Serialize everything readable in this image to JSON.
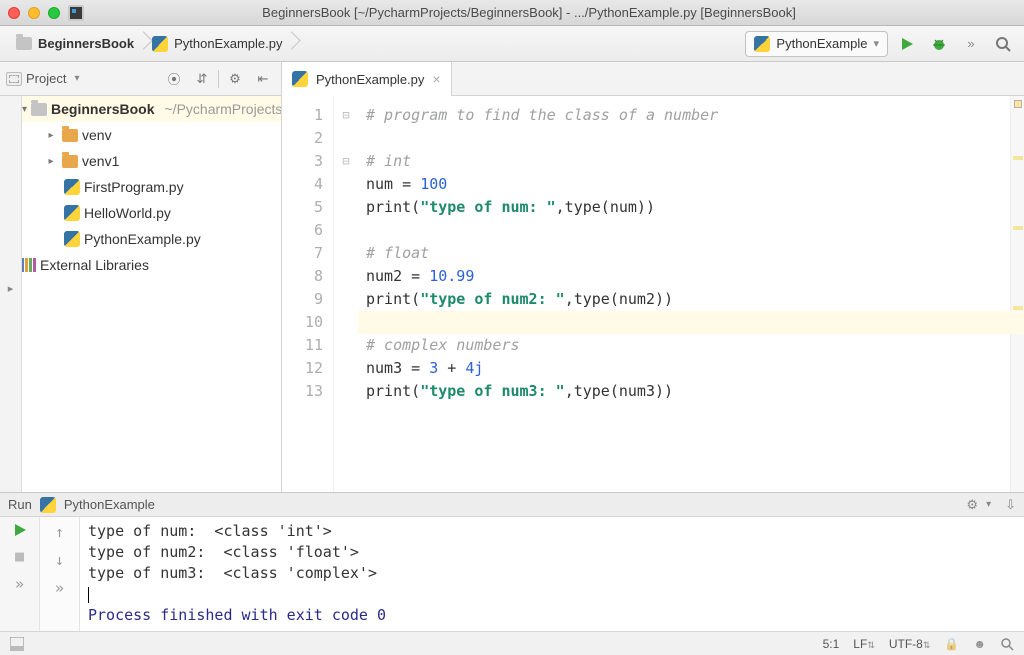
{
  "window": {
    "title": "BeginnersBook [~/PycharmProjects/BeginnersBook] - .../PythonExample.py [BeginnersBook]"
  },
  "breadcrumb": {
    "root": "BeginnersBook",
    "file": "PythonExample.py"
  },
  "run_config": {
    "selected": "PythonExample"
  },
  "project_tool": {
    "label": "Project"
  },
  "tree": {
    "root": {
      "name": "BeginnersBook",
      "path": "~/PycharmProjects/BeginnersBook"
    },
    "items": [
      {
        "name": "venv"
      },
      {
        "name": "venv1"
      },
      {
        "name": "FirstProgram.py"
      },
      {
        "name": "HelloWorld.py"
      },
      {
        "name": "PythonExample.py"
      }
    ],
    "external": "External Libraries"
  },
  "tabs": {
    "active": "PythonExample.py"
  },
  "editor": {
    "lines": [
      {
        "n": "1",
        "fold": "⊟",
        "t": [
          {
            "c": "c-comment",
            "v": "# program to find the class of a number"
          }
        ]
      },
      {
        "n": "2",
        "fold": "",
        "t": [
          {
            "c": "",
            "v": " "
          }
        ]
      },
      {
        "n": "3",
        "fold": "⊟",
        "t": [
          {
            "c": "c-comment",
            "v": "# int"
          }
        ]
      },
      {
        "n": "4",
        "fold": "",
        "t": [
          {
            "c": "",
            "v": "num = "
          },
          {
            "c": "c-num",
            "v": "100"
          }
        ]
      },
      {
        "n": "5",
        "fold": "",
        "t": [
          {
            "c": "",
            "v": "print("
          },
          {
            "c": "c-str",
            "v": "\"type of num: \""
          },
          {
            "c": "",
            "v": ",type(num))"
          }
        ]
      },
      {
        "n": "6",
        "fold": "",
        "t": [
          {
            "c": "",
            "v": " "
          }
        ]
      },
      {
        "n": "7",
        "fold": "",
        "t": [
          {
            "c": "c-comment",
            "v": "# float"
          }
        ]
      },
      {
        "n": "8",
        "fold": "",
        "t": [
          {
            "c": "",
            "v": "num2 = "
          },
          {
            "c": "c-num",
            "v": "10.99"
          }
        ]
      },
      {
        "n": "9",
        "fold": "",
        "t": [
          {
            "c": "",
            "v": "print("
          },
          {
            "c": "c-str",
            "v": "\"type of num2: \""
          },
          {
            "c": "",
            "v": ",type(num2))"
          }
        ]
      },
      {
        "n": "10",
        "fold": "",
        "t": [
          {
            "c": "",
            "v": " "
          }
        ],
        "hl": true
      },
      {
        "n": "11",
        "fold": "",
        "t": [
          {
            "c": "c-comment",
            "v": "# complex numbers"
          }
        ]
      },
      {
        "n": "12",
        "fold": "",
        "t": [
          {
            "c": "",
            "v": "num3 = "
          },
          {
            "c": "c-num",
            "v": "3"
          },
          {
            "c": "",
            "v": " + "
          },
          {
            "c": "c-num",
            "v": "4j"
          }
        ]
      },
      {
        "n": "13",
        "fold": "",
        "t": [
          {
            "c": "",
            "v": "print("
          },
          {
            "c": "c-str",
            "v": "\"type of num3: \""
          },
          {
            "c": "",
            "v": ",type(num3))"
          }
        ]
      }
    ]
  },
  "run": {
    "title_prefix": "Run",
    "title": "PythonExample",
    "output": [
      "type of num:  <class 'int'>",
      "type of num2:  <class 'float'>",
      "type of num3:  <class 'complex'>"
    ],
    "exit": "Process finished with exit code 0"
  },
  "status": {
    "pos": "5:1",
    "sep": "LF",
    "enc": "UTF-8"
  },
  "glyph": {
    "chev_down": "▾",
    "chev_right": "▸",
    "double_angle": "»",
    "updown": "⇵",
    "gear": "⚙",
    "collapse": "⇤",
    "target": "⦿",
    "search": "🔍",
    "download": "⇩",
    "stop": "■",
    "arrow_up": "↑",
    "arrow_down": "↓",
    "bug": "🐞",
    "smiley": "☻",
    "lock": "🔒"
  }
}
